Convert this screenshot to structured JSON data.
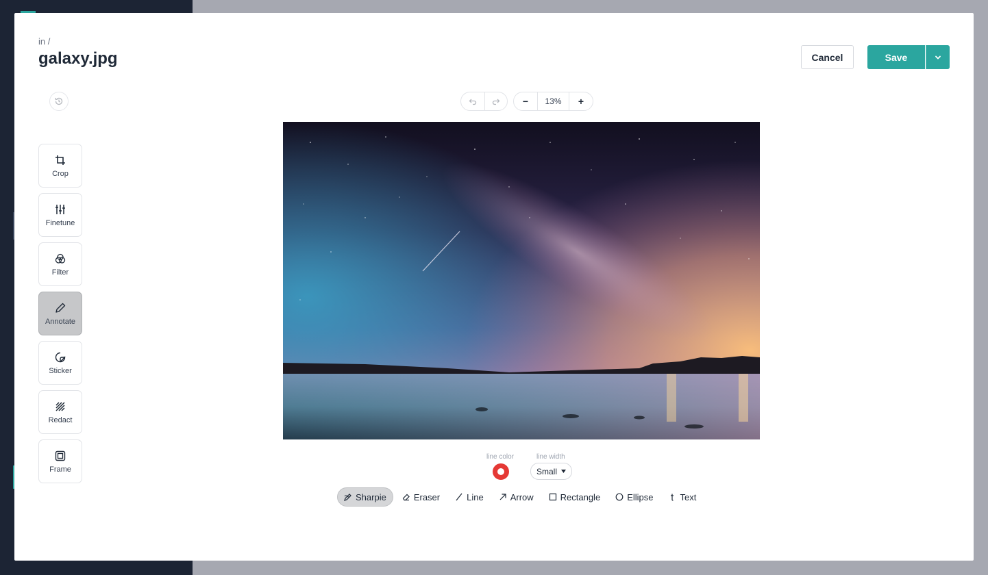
{
  "header": {
    "breadcrumb": "in /",
    "title": "galaxy.jpg",
    "cancel_label": "Cancel",
    "save_label": "Save"
  },
  "zoom": {
    "minus": "−",
    "value": "13%",
    "plus": "+"
  },
  "sidebar": {
    "tools": [
      {
        "label": "Crop",
        "icon": "crop-icon"
      },
      {
        "label": "Finetune",
        "icon": "sliders-icon"
      },
      {
        "label": "Filter",
        "icon": "filter-circles-icon"
      },
      {
        "label": "Annotate",
        "icon": "pencil-icon",
        "active": true
      },
      {
        "label": "Sticker",
        "icon": "sticker-icon"
      },
      {
        "label": "Redact",
        "icon": "redact-hatch-icon"
      },
      {
        "label": "Frame",
        "icon": "frame-icon"
      }
    ]
  },
  "annotate": {
    "line_color_label": "line color",
    "line_width_label": "line width",
    "line_color": "#e53935",
    "line_width_value": "Small",
    "shapes": [
      {
        "label": "Sharpie",
        "icon": "sharpie-icon",
        "active": true
      },
      {
        "label": "Eraser",
        "icon": "eraser-icon"
      },
      {
        "label": "Line",
        "icon": "line-icon"
      },
      {
        "label": "Arrow",
        "icon": "arrow-icon"
      },
      {
        "label": "Rectangle",
        "icon": "rectangle-icon"
      },
      {
        "label": "Ellipse",
        "icon": "ellipse-icon"
      },
      {
        "label": "Text",
        "icon": "text-icon"
      }
    ]
  },
  "colors": {
    "accent": "#2ba69f",
    "background": "#a6a8b1"
  }
}
